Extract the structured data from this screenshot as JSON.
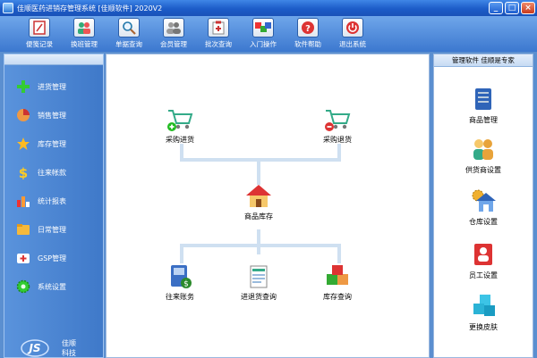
{
  "window": {
    "title": "佳顺医药进销存管理系统 [佳顺软件] 2020V2",
    "buttons": {
      "minimize": "_",
      "maximize": "□",
      "close": "×"
    }
  },
  "toolbar": [
    {
      "label": "便笺记录",
      "icon": "notepad-icon"
    },
    {
      "label": "换班管理",
      "icon": "shift-change-icon"
    },
    {
      "label": "单据查询",
      "icon": "search-icon"
    },
    {
      "label": "会员管理",
      "icon": "members-icon"
    },
    {
      "label": "批次查询",
      "icon": "batch-icon"
    },
    {
      "label": "入门操作",
      "icon": "abc-icon"
    },
    {
      "label": "软件帮助",
      "icon": "help-icon"
    },
    {
      "label": "退出系统",
      "icon": "power-icon"
    }
  ],
  "sidebar": {
    "items": [
      {
        "label": "进货管理",
        "icon": "plus-icon"
      },
      {
        "label": "销售管理",
        "icon": "pie-chart-icon"
      },
      {
        "label": "库存管理",
        "icon": "star-icon"
      },
      {
        "label": "往来帐款",
        "icon": "dollar-icon"
      },
      {
        "label": "统计报表",
        "icon": "bar-chart-icon"
      },
      {
        "label": "日常管理",
        "icon": "folder-icon"
      },
      {
        "label": "GSP管理",
        "icon": "first-aid-icon"
      },
      {
        "label": "系统设置",
        "icon": "gear-icon"
      }
    ],
    "logo_text": "JS",
    "logo_sub": "佳顺",
    "logo_sub2": "科技"
  },
  "flow": {
    "purchase_in": "采购进货",
    "purchase_return": "采购退货",
    "inventory": "商品库存",
    "accounts": "往来账务",
    "in_out_query": "进退货查询",
    "stock_query": "库存查询"
  },
  "right_panel": {
    "header": "管理软件  佳顺是专家",
    "items": [
      {
        "label": "商品管理",
        "icon": "product-icon"
      },
      {
        "label": "供货商设置",
        "icon": "supplier-icon"
      },
      {
        "label": "仓库设置",
        "icon": "warehouse-icon"
      },
      {
        "label": "员工设置",
        "icon": "staff-icon"
      },
      {
        "label": "更换皮肤",
        "icon": "skin-icon"
      }
    ]
  }
}
